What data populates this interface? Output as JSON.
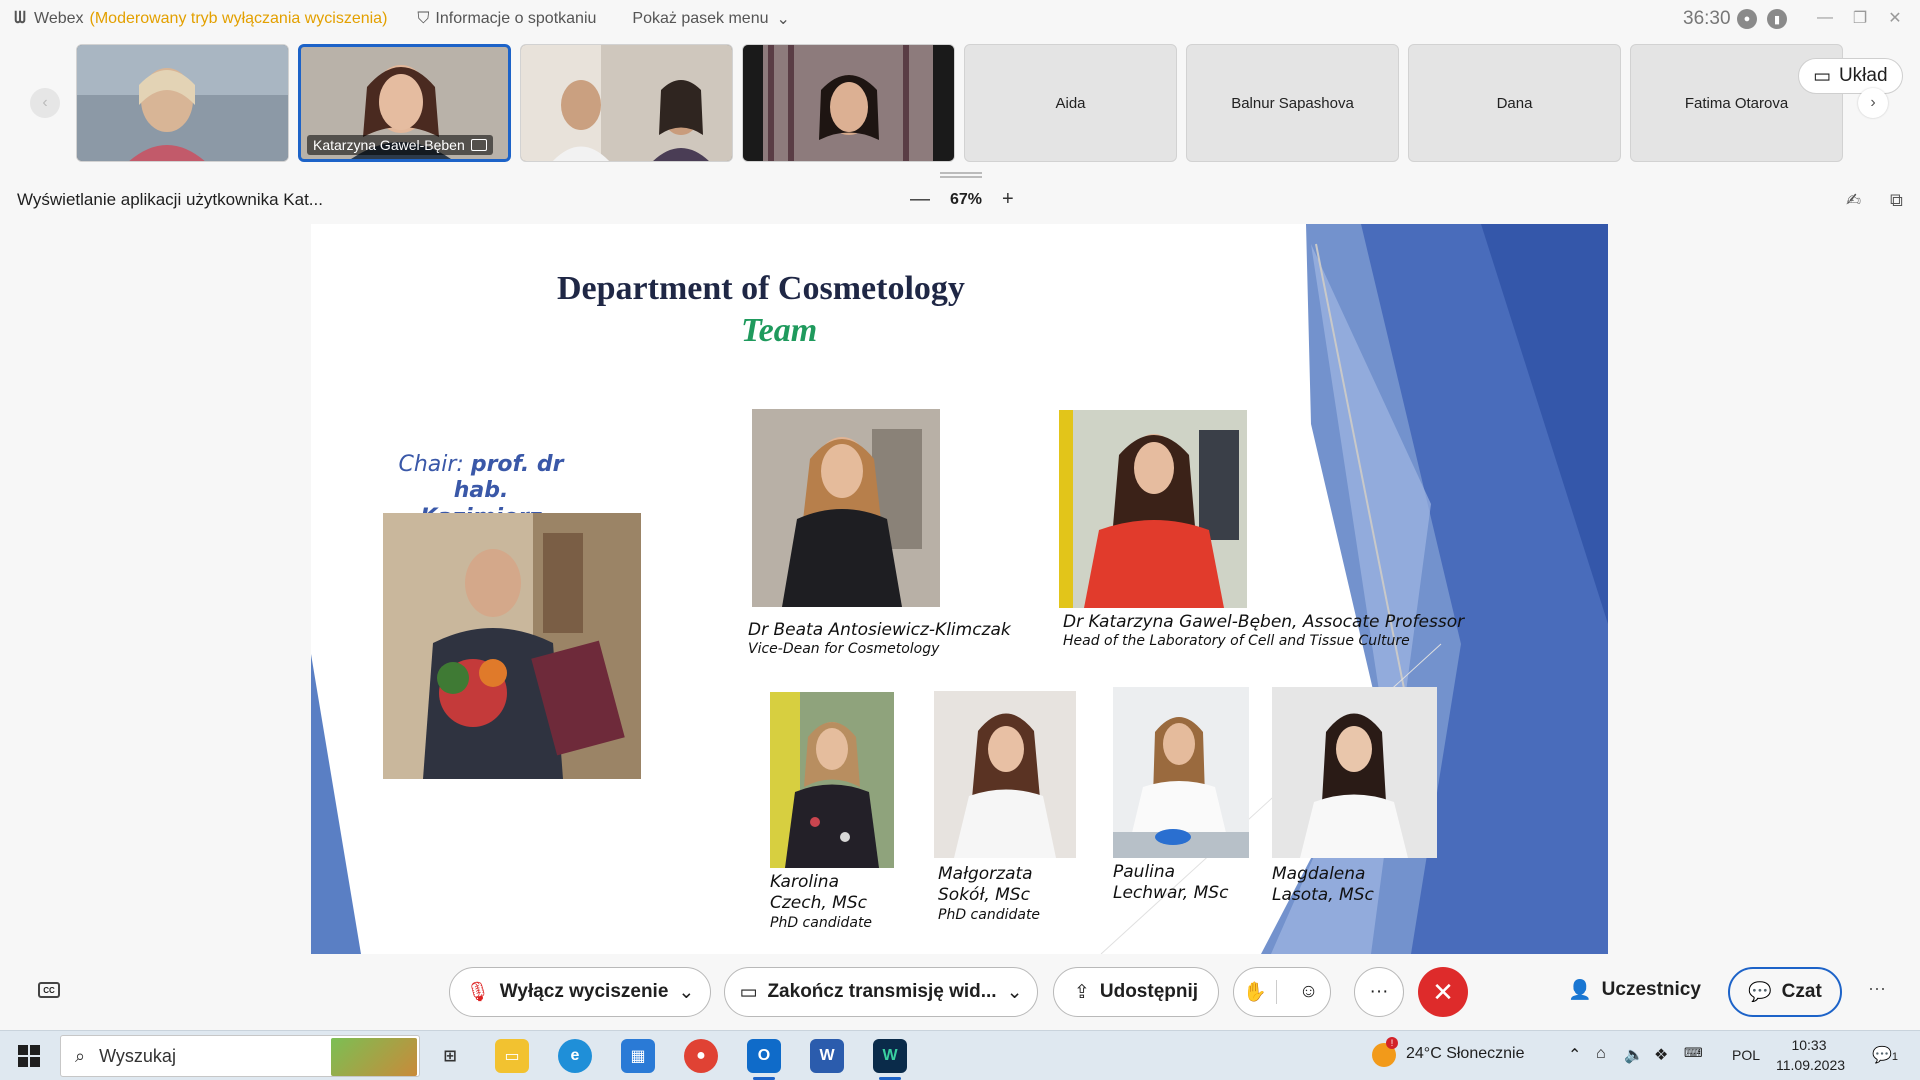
{
  "titlebar": {
    "app_name": "Webex",
    "mode": "(Moderowany tryb wyłączania wyciszenia)",
    "meeting_info": "Informacje o spotkaniu",
    "menu_toggle": "Pokaż pasek menu",
    "timer": "36:30"
  },
  "participants": {
    "tiles": [
      {
        "name": "",
        "video": true
      },
      {
        "name": "Katarzyna Gawel-Bęben",
        "video": true,
        "active": true
      },
      {
        "name": "",
        "video": true
      },
      {
        "name": "",
        "video": true
      },
      {
        "name": "Aida",
        "video": false
      },
      {
        "name": "Balnur Sapashova",
        "video": false
      },
      {
        "name": "Dana",
        "video": false
      },
      {
        "name": "Fatima Otarova",
        "video": false
      }
    ],
    "layout_label": "Układ"
  },
  "share_header": {
    "viewing_text": "Wyświetlanie aplikacji użytkownika Kat...",
    "zoom_level": "67%"
  },
  "slide": {
    "title": "Department of Cosmetology",
    "subtitle": "Team",
    "chair_prefix": "Chair:",
    "chair_name_line1": "prof. dr hab.",
    "chair_name_line2": "Kazimierz Głowniak",
    "members": [
      {
        "name": "Dr Beata Antosiewicz-Klimczak",
        "role": "Vice-Dean for Cosmetology"
      },
      {
        "name": "Dr Katarzyna Gawel-Bęben, Assocate Professor",
        "role": "Head of the Laboratory of Cell and Tissue Culture"
      },
      {
        "name_line1": "Karolina",
        "name_line2": "Czech, MSc",
        "role": "PhD candidate"
      },
      {
        "name_line1": "Małgorzata",
        "name_line2": "Sokół, MSc",
        "role": "PhD candidate"
      },
      {
        "name_line1": "Paulina",
        "name_line2": "Lechwar, MSc",
        "role": ""
      },
      {
        "name_line1": "Magdalena",
        "name_line2": "Lasota, MSc",
        "role": ""
      }
    ]
  },
  "controls": {
    "unmute_label": "Wyłącz wyciszenie",
    "stop_video_label": "Zakończ transmisję wid...",
    "share_label": "Udostępnij",
    "participants_label": "Uczestnicy",
    "chat_label": "Czat",
    "more": "···"
  },
  "taskbar": {
    "search_placeholder": "Wyszukaj",
    "weather": "24°C  Słonecznie",
    "language": "POL",
    "time": "10:33",
    "date": "11.09.2023",
    "notification_badge": "1"
  }
}
